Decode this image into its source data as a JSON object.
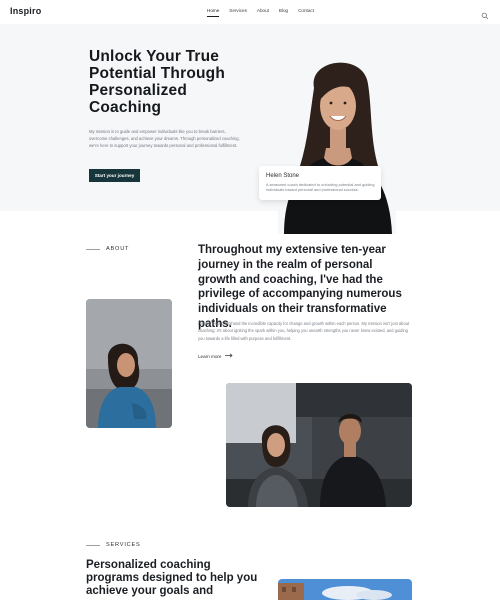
{
  "nav": {
    "logo": "Inspiro",
    "items": [
      {
        "label": "Home",
        "active": true
      },
      {
        "label": "Services",
        "active": false
      },
      {
        "label": "About",
        "active": false
      },
      {
        "label": "Blog",
        "active": false
      },
      {
        "label": "Contact",
        "active": false
      }
    ],
    "search_icon": "search-icon"
  },
  "hero": {
    "title": "Unlock Your True Potential Through Personalized Coaching",
    "text": "My mission is to guide and empower individuals like you to break barriers, overcome challenges, and achieve your dreams. Through personalized coaching, we're here to support your journey towards personal and professional fulfillment.",
    "cta_label": "Start your journey",
    "card": {
      "name": "Helen Stone",
      "description": "A seasoned coach dedicated to unlocking potential and guiding individuals toward personal and professional success."
    }
  },
  "about": {
    "label": "ABOUT",
    "heading": "Throughout my extensive ten-year journey in the realm of personal growth and coaching, I've had the privilege of accompanying numerous individuals on their transformative paths.",
    "text": "I've witnessed firsthand the incredible capacity for change and growth within each person. My mission isn't just about coaching; it's about igniting the spark within you, helping you unearth strengths you never knew existed, and guiding you towards a life filled with purpose and fulfillment.",
    "learn_more": "Learn more",
    "learn_more_icon": "arrow-right-icon"
  },
  "services": {
    "label": "SERVICES",
    "heading": "Personalized coaching programs designed to help you achieve your goals and"
  },
  "colors": {
    "accent": "#17363c",
    "hero_bg": "#f6f7f9",
    "text_dark": "#1b1f24",
    "text_muted": "#7a8088"
  }
}
